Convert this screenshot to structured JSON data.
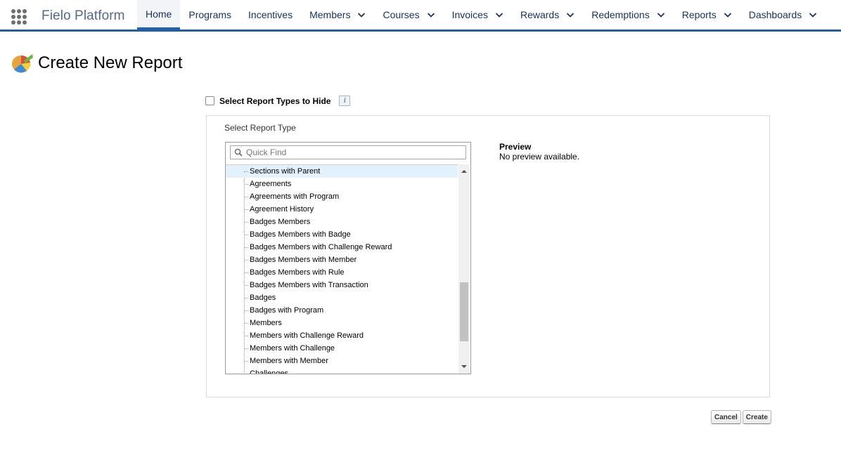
{
  "app": {
    "name": "Fielo Platform",
    "icon": "app-launcher-waffle-icon"
  },
  "nav": {
    "items": [
      {
        "label": "Home",
        "active": true,
        "dropdown": false
      },
      {
        "label": "Programs",
        "active": false,
        "dropdown": false
      },
      {
        "label": "Incentives",
        "active": false,
        "dropdown": false
      },
      {
        "label": "Members",
        "active": false,
        "dropdown": true
      },
      {
        "label": "Courses",
        "active": false,
        "dropdown": true
      },
      {
        "label": "Invoices",
        "active": false,
        "dropdown": true
      },
      {
        "label": "Rewards",
        "active": false,
        "dropdown": true
      },
      {
        "label": "Redemptions",
        "active": false,
        "dropdown": true
      },
      {
        "label": "Reports",
        "active": false,
        "dropdown": true
      },
      {
        "label": "Dashboards",
        "active": false,
        "dropdown": true
      }
    ]
  },
  "page": {
    "title": "Create New Report",
    "icon": "report-pie-icon"
  },
  "hide_types": {
    "label": "Select Report Types to Hide",
    "checked": false,
    "info_label": "i"
  },
  "report_type": {
    "label": "Select Report Type",
    "search_placeholder": "Quick Find",
    "search_value": "",
    "items": [
      {
        "label": "Sections with Parent",
        "selected": true
      },
      {
        "label": "Agreements",
        "selected": false
      },
      {
        "label": "Agreements with Program",
        "selected": false
      },
      {
        "label": "Agreement History",
        "selected": false
      },
      {
        "label": "Badges Members",
        "selected": false
      },
      {
        "label": "Badges Members with Badge",
        "selected": false
      },
      {
        "label": "Badges Members with Challenge Reward",
        "selected": false
      },
      {
        "label": "Badges Members with Member",
        "selected": false
      },
      {
        "label": "Badges Members with Rule",
        "selected": false
      },
      {
        "label": "Badges Members with Transaction",
        "selected": false
      },
      {
        "label": "Badges",
        "selected": false
      },
      {
        "label": "Badges with Program",
        "selected": false
      },
      {
        "label": "Members",
        "selected": false
      },
      {
        "label": "Members with Challenge Reward",
        "selected": false
      },
      {
        "label": "Members with Challenge",
        "selected": false
      },
      {
        "label": "Members with Member",
        "selected": false
      },
      {
        "label": "Challenges",
        "selected": false
      }
    ]
  },
  "preview": {
    "title": "Preview",
    "text": "No preview available."
  },
  "actions": {
    "cancel_label": "Cancel",
    "create_label": "Create"
  },
  "colors": {
    "brand": "#1f5fae",
    "selected_row": "#e3f1fd"
  }
}
